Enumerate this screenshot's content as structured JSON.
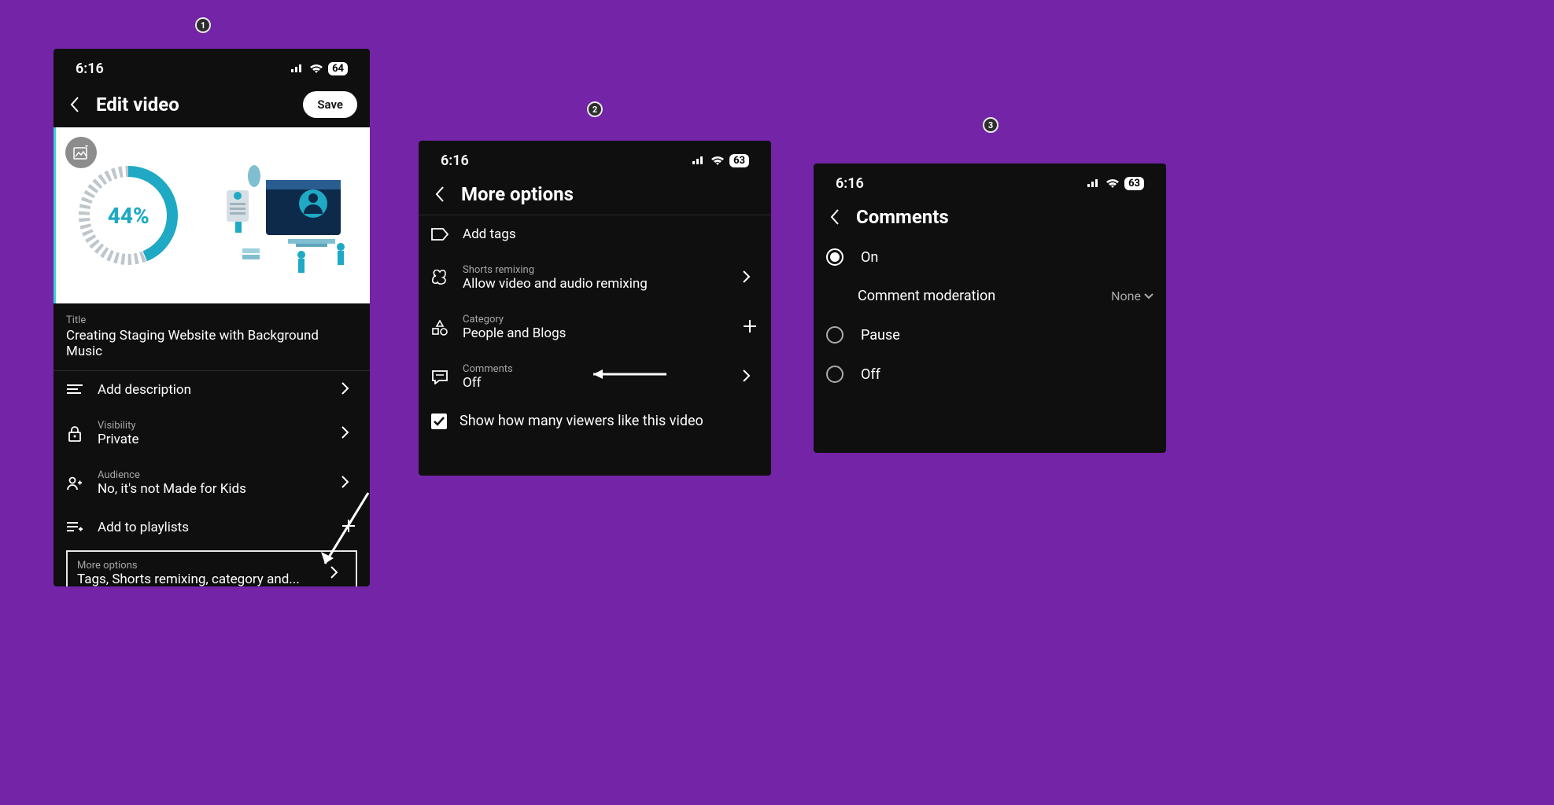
{
  "badges": {
    "one": "1",
    "two": "2",
    "three": "3"
  },
  "screen1": {
    "statusbar": {
      "time": "6:16",
      "battery": "64"
    },
    "header": {
      "title": "Edit video",
      "save": "Save"
    },
    "thumbnail": {
      "percent": "44%"
    },
    "title": {
      "label": "Title",
      "value": "Creating Staging Website with Background Music"
    },
    "rows": {
      "description": "Add description",
      "visibility_label": "Visibility",
      "visibility_value": "Private",
      "audience_label": "Audience",
      "audience_value": "No, it's not Made for Kids",
      "playlists": "Add to playlists",
      "more_label": "More options",
      "more_value": "Tags, Shorts remixing, category and..."
    }
  },
  "screen2": {
    "statusbar": {
      "time": "6:16",
      "battery": "63"
    },
    "header": {
      "title": "More options"
    },
    "rows": {
      "tags": "Add tags",
      "shorts_label": "Shorts remixing",
      "shorts_value": "Allow video and audio remixing",
      "category_label": "Category",
      "category_value": "People and Blogs",
      "comments_label": "Comments",
      "comments_value": "Off",
      "show_likes": "Show how many viewers like this video"
    }
  },
  "screen3": {
    "statusbar": {
      "time": "6:16",
      "battery": "63"
    },
    "header": {
      "title": "Comments"
    },
    "options": {
      "on": "On",
      "pause": "Pause",
      "off": "Off"
    },
    "moderation": {
      "label": "Comment moderation",
      "value": "None"
    }
  }
}
